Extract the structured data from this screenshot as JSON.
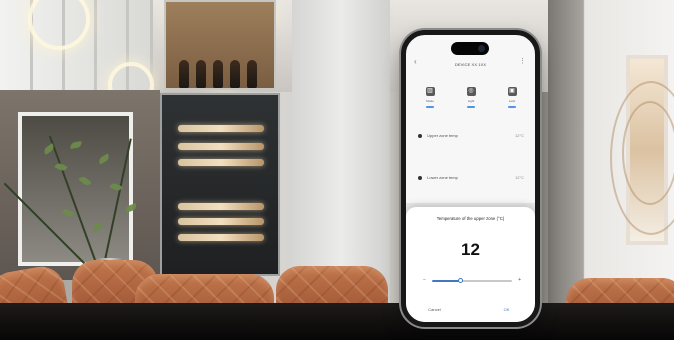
{
  "app": {
    "title": "DEVICE XX 1XX"
  },
  "top_bar": {
    "back_icon": "back-arrow-icon",
    "more_icon": "more-icon"
  },
  "mode_items": [
    {
      "label": "Mode",
      "icon": "wine-cabinet-icon"
    },
    {
      "label": "Light",
      "icon": "light-icon"
    },
    {
      "label": "Lock",
      "icon": "lock-icon"
    }
  ],
  "settings": [
    {
      "label": "Upper zone temp",
      "value": "12°C"
    },
    {
      "label": "Lower zone temp",
      "value": "12°C"
    }
  ],
  "temperature_modal": {
    "title": "Temperature of the upper zone (°C)",
    "value": "12",
    "slider_fraction": 0.35,
    "minus_label": "−",
    "plus_label": "+",
    "cancel_label": "Cancel",
    "ok_label": "OK"
  },
  "colors": {
    "accent": "#4178c0",
    "phone_frame": "#181818",
    "chair_leather": "#b26a43"
  }
}
